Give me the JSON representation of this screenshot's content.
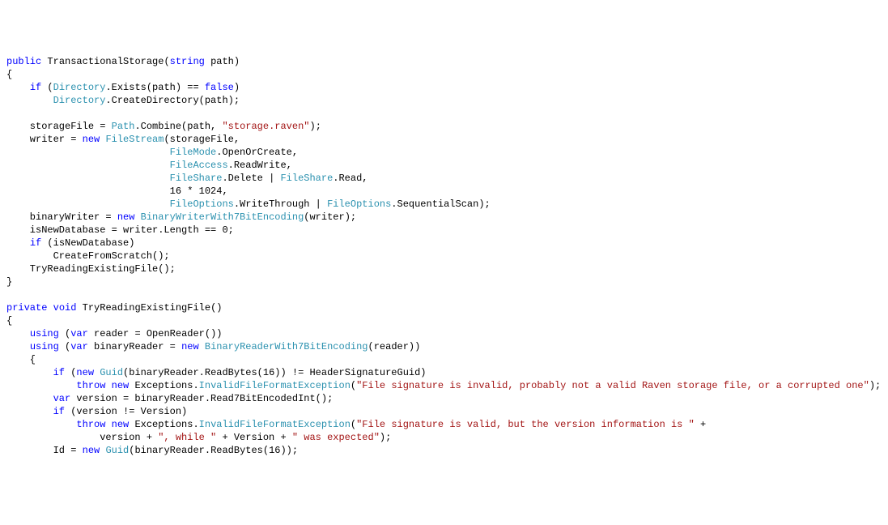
{
  "code": {
    "lines": [
      [
        {
          "c": "kw",
          "t": "public"
        },
        {
          "c": "pln",
          "t": " TransactionalStorage("
        },
        {
          "c": "kw",
          "t": "string"
        },
        {
          "c": "pln",
          "t": " path)"
        }
      ],
      [
        {
          "c": "pln",
          "t": "{"
        }
      ],
      [
        {
          "c": "pln",
          "t": "    "
        },
        {
          "c": "kw",
          "t": "if"
        },
        {
          "c": "pln",
          "t": " ("
        },
        {
          "c": "typ",
          "t": "Directory"
        },
        {
          "c": "pln",
          "t": ".Exists(path) == "
        },
        {
          "c": "kw",
          "t": "false"
        },
        {
          "c": "pln",
          "t": ")"
        }
      ],
      [
        {
          "c": "pln",
          "t": "        "
        },
        {
          "c": "typ",
          "t": "Directory"
        },
        {
          "c": "pln",
          "t": ".CreateDirectory(path);"
        }
      ],
      [
        {
          "c": "pln",
          "t": ""
        }
      ],
      [
        {
          "c": "pln",
          "t": "    storageFile = "
        },
        {
          "c": "typ",
          "t": "Path"
        },
        {
          "c": "pln",
          "t": ".Combine(path, "
        },
        {
          "c": "str",
          "t": "\"storage.raven\""
        },
        {
          "c": "pln",
          "t": ");"
        }
      ],
      [
        {
          "c": "pln",
          "t": "    writer = "
        },
        {
          "c": "kw",
          "t": "new"
        },
        {
          "c": "pln",
          "t": " "
        },
        {
          "c": "typ",
          "t": "FileStream"
        },
        {
          "c": "pln",
          "t": "(storageFile,"
        }
      ],
      [
        {
          "c": "pln",
          "t": "                            "
        },
        {
          "c": "typ",
          "t": "FileMode"
        },
        {
          "c": "pln",
          "t": ".OpenOrCreate,"
        }
      ],
      [
        {
          "c": "pln",
          "t": "                            "
        },
        {
          "c": "typ",
          "t": "FileAccess"
        },
        {
          "c": "pln",
          "t": ".ReadWrite,"
        }
      ],
      [
        {
          "c": "pln",
          "t": "                            "
        },
        {
          "c": "typ",
          "t": "FileShare"
        },
        {
          "c": "pln",
          "t": ".Delete | "
        },
        {
          "c": "typ",
          "t": "FileShare"
        },
        {
          "c": "pln",
          "t": ".Read,"
        }
      ],
      [
        {
          "c": "pln",
          "t": "                            16 * 1024,"
        }
      ],
      [
        {
          "c": "pln",
          "t": "                            "
        },
        {
          "c": "typ",
          "t": "FileOptions"
        },
        {
          "c": "pln",
          "t": ".WriteThrough | "
        },
        {
          "c": "typ",
          "t": "FileOptions"
        },
        {
          "c": "pln",
          "t": ".SequentialScan);"
        }
      ],
      [
        {
          "c": "pln",
          "t": "    binaryWriter = "
        },
        {
          "c": "kw",
          "t": "new"
        },
        {
          "c": "pln",
          "t": " "
        },
        {
          "c": "typ",
          "t": "BinaryWriterWith7BitEncoding"
        },
        {
          "c": "pln",
          "t": "(writer);"
        }
      ],
      [
        {
          "c": "pln",
          "t": "    isNewDatabase = writer.Length == 0;"
        }
      ],
      [
        {
          "c": "pln",
          "t": "    "
        },
        {
          "c": "kw",
          "t": "if"
        },
        {
          "c": "pln",
          "t": " (isNewDatabase)"
        }
      ],
      [
        {
          "c": "pln",
          "t": "        CreateFromScratch();"
        }
      ],
      [
        {
          "c": "pln",
          "t": "    TryReadingExistingFile();"
        }
      ],
      [
        {
          "c": "pln",
          "t": "}"
        }
      ],
      [
        {
          "c": "pln",
          "t": ""
        }
      ],
      [
        {
          "c": "kw",
          "t": "private"
        },
        {
          "c": "pln",
          "t": " "
        },
        {
          "c": "kw",
          "t": "void"
        },
        {
          "c": "pln",
          "t": " TryReadingExistingFile()"
        }
      ],
      [
        {
          "c": "pln",
          "t": "{"
        }
      ],
      [
        {
          "c": "pln",
          "t": "    "
        },
        {
          "c": "kw",
          "t": "using"
        },
        {
          "c": "pln",
          "t": " ("
        },
        {
          "c": "kw",
          "t": "var"
        },
        {
          "c": "pln",
          "t": " reader = OpenReader())"
        }
      ],
      [
        {
          "c": "pln",
          "t": "    "
        },
        {
          "c": "kw",
          "t": "using"
        },
        {
          "c": "pln",
          "t": " ("
        },
        {
          "c": "kw",
          "t": "var"
        },
        {
          "c": "pln",
          "t": " binaryReader = "
        },
        {
          "c": "kw",
          "t": "new"
        },
        {
          "c": "pln",
          "t": " "
        },
        {
          "c": "typ",
          "t": "BinaryReaderWith7BitEncoding"
        },
        {
          "c": "pln",
          "t": "(reader))"
        }
      ],
      [
        {
          "c": "pln",
          "t": "    {"
        }
      ],
      [
        {
          "c": "pln",
          "t": "        "
        },
        {
          "c": "kw",
          "t": "if"
        },
        {
          "c": "pln",
          "t": " ("
        },
        {
          "c": "kw",
          "t": "new"
        },
        {
          "c": "pln",
          "t": " "
        },
        {
          "c": "typ",
          "t": "Guid"
        },
        {
          "c": "pln",
          "t": "(binaryReader.ReadBytes(16)) != HeaderSignatureGuid)"
        }
      ],
      [
        {
          "c": "pln",
          "t": "            "
        },
        {
          "c": "kw",
          "t": "throw"
        },
        {
          "c": "pln",
          "t": " "
        },
        {
          "c": "kw",
          "t": "new"
        },
        {
          "c": "pln",
          "t": " Exceptions."
        },
        {
          "c": "typ",
          "t": "InvalidFileFormatException"
        },
        {
          "c": "pln",
          "t": "("
        },
        {
          "c": "str",
          "t": "\"File signature is invalid, probably not a valid Raven storage file, or a corrupted one\""
        },
        {
          "c": "pln",
          "t": ");"
        }
      ],
      [
        {
          "c": "pln",
          "t": "        "
        },
        {
          "c": "kw",
          "t": "var"
        },
        {
          "c": "pln",
          "t": " version = binaryReader.Read7BitEncodedInt();"
        }
      ],
      [
        {
          "c": "pln",
          "t": "        "
        },
        {
          "c": "kw",
          "t": "if"
        },
        {
          "c": "pln",
          "t": " (version != Version)"
        }
      ],
      [
        {
          "c": "pln",
          "t": "            "
        },
        {
          "c": "kw",
          "t": "throw"
        },
        {
          "c": "pln",
          "t": " "
        },
        {
          "c": "kw",
          "t": "new"
        },
        {
          "c": "pln",
          "t": " Exceptions."
        },
        {
          "c": "typ",
          "t": "InvalidFileFormatException"
        },
        {
          "c": "pln",
          "t": "("
        },
        {
          "c": "str",
          "t": "\"File signature is valid, but the version information is \""
        },
        {
          "c": "pln",
          "t": " +"
        }
      ],
      [
        {
          "c": "pln",
          "t": "                version + "
        },
        {
          "c": "str",
          "t": "\", while \""
        },
        {
          "c": "pln",
          "t": " + Version + "
        },
        {
          "c": "str",
          "t": "\" was expected\""
        },
        {
          "c": "pln",
          "t": ");"
        }
      ],
      [
        {
          "c": "pln",
          "t": "        Id = "
        },
        {
          "c": "kw",
          "t": "new"
        },
        {
          "c": "pln",
          "t": " "
        },
        {
          "c": "typ",
          "t": "Guid"
        },
        {
          "c": "pln",
          "t": "(binaryReader.ReadBytes(16));"
        }
      ]
    ]
  }
}
